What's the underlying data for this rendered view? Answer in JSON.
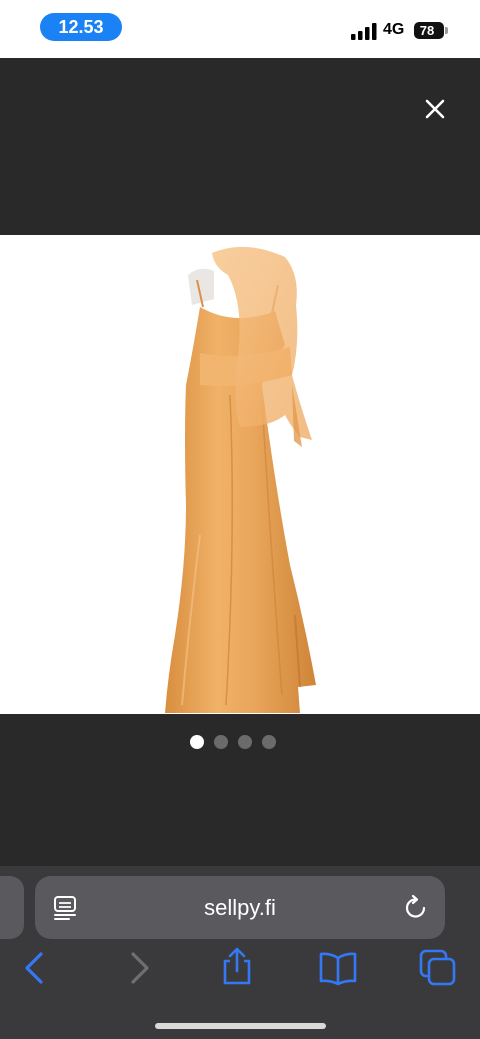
{
  "status_bar": {
    "time": "12.53",
    "network": "4G",
    "battery": "78"
  },
  "viewer": {
    "image_count": 4,
    "active_index": 0
  },
  "browser": {
    "url": "sellpy.fi"
  },
  "colors": {
    "time_pill": "#1a82f5",
    "viewer_bg": "#292929",
    "toolbar_bg": "#3a3a3c",
    "url_field_bg": "#5a5a5e",
    "toolbar_icon": "#3478f6",
    "dress": "#e8a65a"
  },
  "icons": {
    "close": "close-icon",
    "reader": "reader-mode-icon",
    "reload": "reload-icon",
    "back": "chevron-left-icon",
    "forward": "chevron-right-icon",
    "share": "share-icon",
    "bookmarks": "open-book-icon",
    "tabs": "tabs-icon"
  }
}
